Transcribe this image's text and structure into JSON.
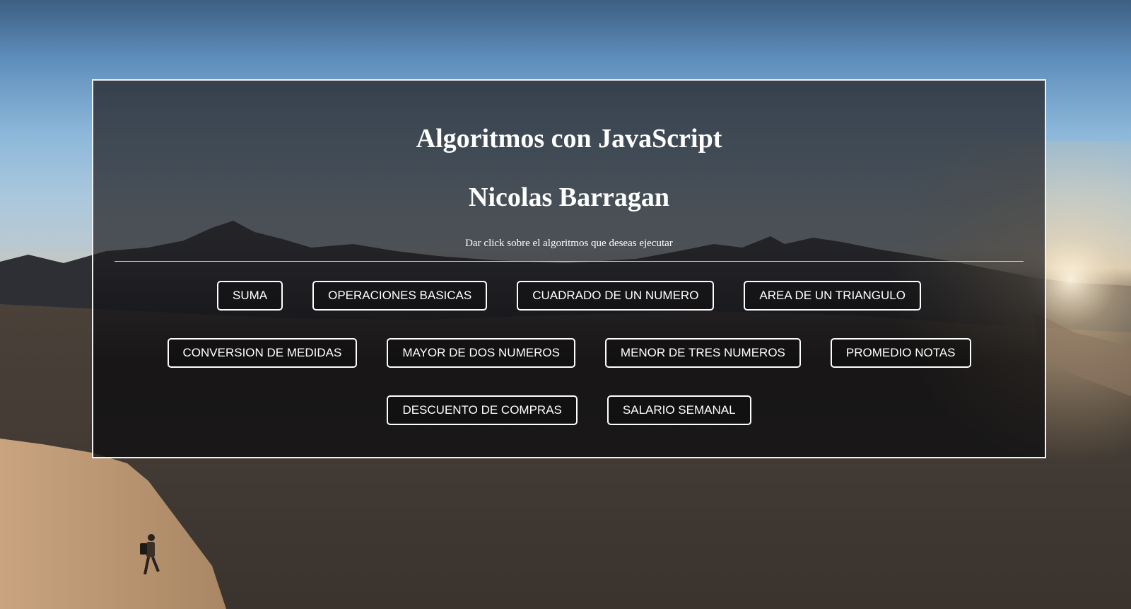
{
  "page": {
    "title": "Algoritmos con JavaScript",
    "author": "Nicolas Barragan",
    "instructions": "Dar click sobre el algoritmos que deseas ejecutar"
  },
  "buttons": {
    "row1": [
      "SUMA",
      "OPERACIONES BASICAS",
      "CUADRADO DE UN NUMERO",
      "AREA DE UN TRIANGULO"
    ],
    "row2": [
      "CONVERSION DE MEDIDAS",
      "MAYOR DE DOS NUMEROS",
      "MENOR DE TRES NUMEROS",
      "PROMEDIO NOTAS"
    ],
    "row3": [
      "DESCUENTO DE COMPRAS",
      "SALARIO SEMANAL"
    ]
  },
  "colors": {
    "text": "#ffffff",
    "panel_border": "#f2f2f2",
    "button_border": "#ffffff"
  }
}
